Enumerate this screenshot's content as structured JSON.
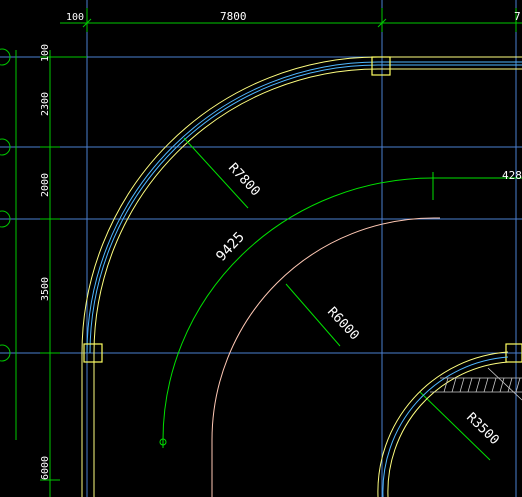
{
  "viewport": {
    "background": "#000000",
    "colors": {
      "grid": "#4a7fd0",
      "dimension": "#00c800",
      "wall": "#ffff80",
      "wall_inner": "#50b8ff",
      "arc_green": "#00e000",
      "arc_pink": "#ffc8b4",
      "column": "#ffff60",
      "text": "#ffffff",
      "axis_bubble": "#00c800"
    }
  },
  "dimensions_top": {
    "d1": "100",
    "d2": "7800",
    "d3": "7"
  },
  "dimensions_left": {
    "d1": "100",
    "d2": "2300",
    "d3": "2000",
    "d4": "3500",
    "d5": "6000"
  },
  "annotations": {
    "radius_outer": "R7800",
    "radius_mid": "R6000",
    "radius_small": "R3500",
    "arc_length": "9425",
    "right_dim": "428"
  }
}
